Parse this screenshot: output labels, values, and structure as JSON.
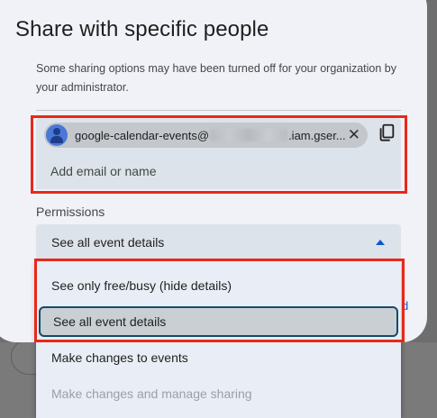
{
  "dialog": {
    "title": "Share with specific people",
    "notice": "Some sharing options may have been turned off for your organization by your administrator."
  },
  "chip": {
    "email_prefix": "google-calendar-events@",
    "email_suffix": ".iam.gser...",
    "remove_symbol": "✕",
    "avatar_icon": "person-icon",
    "copy_icon": "copy-icon"
  },
  "add_input": {
    "placeholder": "Add email or name",
    "value": ""
  },
  "permissions": {
    "label": "Permissions",
    "selected": "See all event details"
  },
  "menu": {
    "options": [
      {
        "label": "See only free/busy (hide details)",
        "state": "enabled"
      },
      {
        "label": "See all event details",
        "state": "selected"
      },
      {
        "label": "Make changes to events",
        "state": "enabled"
      },
      {
        "label": "Make changes and manage sharing",
        "state": "disabled"
      }
    ]
  },
  "background": {
    "peek_link": "d"
  },
  "colors": {
    "highlight_border": "#e8281a",
    "accent": "#0b57d0",
    "selected_outline": "#154a6b"
  }
}
